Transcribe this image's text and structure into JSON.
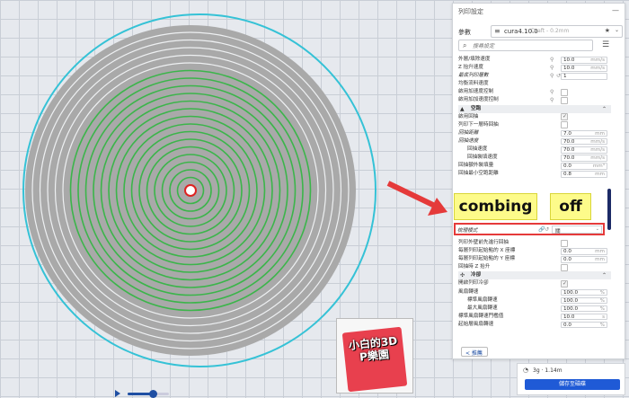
{
  "panel": {
    "title": "列印設定",
    "profile_label": "參數",
    "profile_name": "cura4.10.0",
    "profile_sub": "Draft - 0.2mm",
    "search_placeholder": "搜尋設定",
    "back_label": "< 推薦"
  },
  "rows": [
    {
      "label": "外層/填除速度",
      "value": "10.0",
      "unit": "mm/s",
      "link": true
    },
    {
      "label": "Z 抬升速度",
      "value": "10.0",
      "unit": "mm/s",
      "link": true
    },
    {
      "label": "最底列印層數",
      "value": "1",
      "link": true,
      "reset": true,
      "italic": true
    },
    {
      "label": "均衡流料速度"
    },
    {
      "label": "啟用加速度控制",
      "check": "off",
      "link": true
    },
    {
      "label": "啟用加加速度控制",
      "check": "off",
      "link": true
    },
    {
      "section": true,
      "label": "空跑",
      "icon": "▲"
    },
    {
      "label": "啟用回抽",
      "check": "on"
    },
    {
      "label": "列印下一層時回抽",
      "check": "off"
    },
    {
      "label": "回抽距離",
      "value": "7.0",
      "unit": "mm",
      "italic": true
    },
    {
      "label": "回抽速度",
      "value": "70.0",
      "unit": "mm/s",
      "italic": true
    },
    {
      "label": "回抽速度",
      "value": "70.0",
      "unit": "mm/s",
      "indent": true
    },
    {
      "label": "回抽裝填速度",
      "value": "70.0",
      "unit": "mm/s",
      "indent": true
    },
    {
      "label": "回抽額外裝填量",
      "value": "0.0",
      "unit": "mm³"
    },
    {
      "label": "回抽最小空跑距離",
      "value": "0.8",
      "unit": "mm"
    }
  ],
  "rows_after": [
    {
      "label": "列印外壁前先進行回抽",
      "check": "off"
    },
    {
      "label": "每層列印起始點的 X 座標",
      "value": "0.0",
      "unit": "mm"
    },
    {
      "label": "每層列印起始點的 Y 座標",
      "value": "0.0",
      "unit": "mm"
    },
    {
      "label": "回抽時 Z 抬升",
      "check": "off"
    },
    {
      "section": true,
      "label": "冷卻",
      "icon": "✣"
    },
    {
      "label": "開啟列印冷卻",
      "check": "on"
    },
    {
      "label": "風扇轉速",
      "value": "100.0",
      "unit": "%"
    },
    {
      "label": "標準風扇轉速",
      "value": "100.0",
      "unit": "%",
      "indent": true
    },
    {
      "label": "最大風扇轉速",
      "value": "100.0",
      "unit": "%",
      "indent": true
    },
    {
      "label": "標準風扇轉速門檻值",
      "value": "10.0",
      "unit": "s"
    },
    {
      "label": "起始層風扇轉速",
      "value": "0.0",
      "unit": "%"
    }
  ],
  "highlight": {
    "label": "梳理模式",
    "value": "關"
  },
  "callouts": {
    "combing": "combing",
    "off": "off"
  },
  "estimate": {
    "text": "3g · 1.14m",
    "save": "儲存至磁碟"
  },
  "stamp": {
    "line1": "小白的3D",
    "line2": "P樂園"
  },
  "slider": {
    "value": 0.6
  },
  "colors": {
    "accent": "#1f5ad6",
    "spiral": "#a9a9a9",
    "green": "#3bb54a",
    "cyan": "#3cc0d4",
    "highlight": "#e53a3a"
  }
}
